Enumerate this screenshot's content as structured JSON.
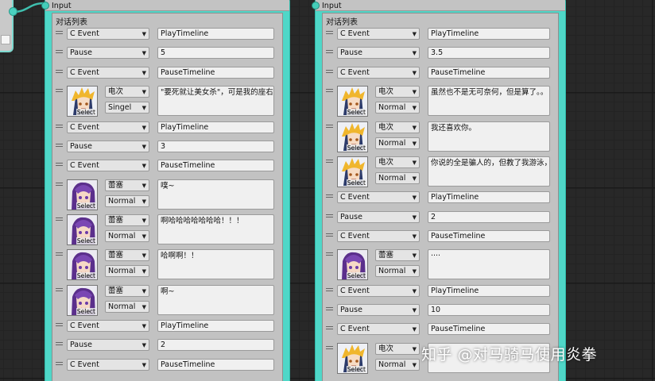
{
  "colors": {
    "node_accent": "#4fd7c8",
    "panel": "#c2c2c2",
    "graph_bg": "#282828"
  },
  "nodes": [
    {
      "input_label": "Input",
      "list_title": "对话列表",
      "rows": [
        {
          "kind": "field",
          "select": "C Event",
          "value": "PlayTimeline"
        },
        {
          "kind": "field",
          "select": "Pause",
          "value": "5"
        },
        {
          "kind": "field",
          "select": "C Event",
          "value": "PauseTimeline"
        },
        {
          "kind": "dialog",
          "character": "blonde",
          "select_label": "Select",
          "speaker": "电次",
          "mode": "Singel",
          "text": "\"要死就让美女杀\"，可是我的座右铭"
        },
        {
          "kind": "field",
          "select": "C Event",
          "value": "PlayTimeline"
        },
        {
          "kind": "field",
          "select": "Pause",
          "value": "3"
        },
        {
          "kind": "field",
          "select": "C Event",
          "value": "PauseTimeline"
        },
        {
          "kind": "dialog",
          "character": "purple",
          "select_label": "Select",
          "speaker": "蕾塞",
          "mode": "Normal",
          "text": "噗~"
        },
        {
          "kind": "dialog",
          "character": "purple",
          "select_label": "Select",
          "speaker": "蕾塞",
          "mode": "Normal",
          "text": "啊哈哈哈哈哈哈哈！！！"
        },
        {
          "kind": "dialog",
          "character": "purple",
          "select_label": "Select",
          "speaker": "蕾塞",
          "mode": "Normal",
          "text": "哈啊啊！！"
        },
        {
          "kind": "dialog",
          "character": "purple",
          "select_label": "Select",
          "speaker": "蕾塞",
          "mode": "Normal",
          "text": "啊~"
        },
        {
          "kind": "field",
          "select": "C Event",
          "value": "PlayTimeline"
        },
        {
          "kind": "field",
          "select": "Pause",
          "value": "2"
        },
        {
          "kind": "field",
          "select": "C Event",
          "value": "PauseTimeline"
        }
      ]
    },
    {
      "input_label": "Input",
      "list_title": "对话列表",
      "rows": [
        {
          "kind": "field",
          "select": "C Event",
          "value": "PlayTimeline"
        },
        {
          "kind": "field",
          "select": "Pause",
          "value": "3.5"
        },
        {
          "kind": "field",
          "select": "C Event",
          "value": "PauseTimeline"
        },
        {
          "kind": "dialog",
          "character": "blonde",
          "select_label": "Select",
          "speaker": "电次",
          "mode": "Normal",
          "text": "虽然也不是无可奈何，但是算了。。"
        },
        {
          "kind": "dialog",
          "character": "blonde",
          "select_label": "Select",
          "speaker": "电次",
          "mode": "Normal",
          "text": "我还喜欢你。"
        },
        {
          "kind": "dialog",
          "character": "blonde",
          "select_label": "Select",
          "speaker": "电次",
          "mode": "Normal",
          "text": "你说的全是骗人的，但教了我游泳，"
        },
        {
          "kind": "field",
          "select": "C Event",
          "value": "PlayTimeline"
        },
        {
          "kind": "field",
          "select": "Pause",
          "value": "2"
        },
        {
          "kind": "field",
          "select": "C Event",
          "value": "PauseTimeline"
        },
        {
          "kind": "dialog",
          "character": "purple",
          "select_label": "Select",
          "speaker": "蕾塞",
          "mode": "Normal",
          "text": "····"
        },
        {
          "kind": "field",
          "select": "C Event",
          "value": "PlayTimeline"
        },
        {
          "kind": "field",
          "select": "Pause",
          "value": "10"
        },
        {
          "kind": "field",
          "select": "C Event",
          "value": "PauseTimeline"
        },
        {
          "kind": "dialog",
          "character": "blonde",
          "select_label": "Select",
          "speaker": "电次",
          "mode": "Normal",
          "text": ""
        }
      ]
    }
  ],
  "watermark": "知乎 @对马骑马使用炎拳"
}
